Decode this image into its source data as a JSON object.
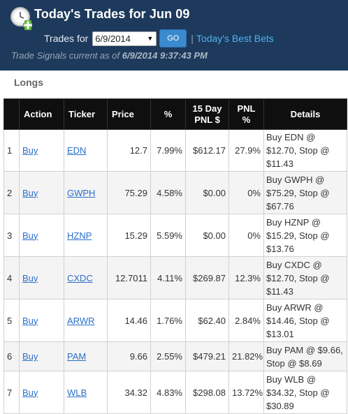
{
  "header": {
    "title": "Today's Trades for Jun 09",
    "trades_for_label": "Trades for",
    "date_value": "6/9/2014",
    "go_label": "GO",
    "separator": "|",
    "best_bets_link": "Today's Best Bets",
    "signals_prefix": "Trade Signals current as of",
    "signals_time": "6/9/2014 9:37:43 PM"
  },
  "section": {
    "title": "Longs"
  },
  "table": {
    "headers": {
      "index": "",
      "action": "Action",
      "ticker": "Ticker",
      "price": "Price",
      "pct": "%",
      "pnl15_line1": "15 Day",
      "pnl15_line2": "PNL $",
      "pnlpct_line1": "PNL",
      "pnlpct_line2": "%",
      "details": "Details"
    },
    "rows": [
      {
        "index": "1",
        "action": "Buy",
        "ticker": "EDN",
        "price": "12.7",
        "pct": "7.99%",
        "pnl15": "$612.17",
        "pnlpct": "27.9%",
        "details": "Buy EDN @ $12.70, Stop @ $11.43"
      },
      {
        "index": "2",
        "action": "Buy",
        "ticker": "GWPH",
        "price": "75.29",
        "pct": "4.58%",
        "pnl15": "$0.00",
        "pnlpct": "0%",
        "details": "Buy GWPH @ $75.29, Stop @ $67.76"
      },
      {
        "index": "3",
        "action": "Buy",
        "ticker": "HZNP",
        "price": "15.29",
        "pct": "5.59%",
        "pnl15": "$0.00",
        "pnlpct": "0%",
        "details": "Buy HZNP @ $15.29, Stop @ $13.76"
      },
      {
        "index": "4",
        "action": "Buy",
        "ticker": "CXDC",
        "price": "12.7011",
        "pct": "4.11%",
        "pnl15": "$269.87",
        "pnlpct": "12.3%",
        "details": "Buy CXDC @ $12.70, Stop @ $11.43"
      },
      {
        "index": "5",
        "action": "Buy",
        "ticker": "ARWR",
        "price": "14.46",
        "pct": "1.76%",
        "pnl15": "$62.40",
        "pnlpct": "2.84%",
        "details": "Buy ARWR @ $14.46, Stop @ $13.01"
      },
      {
        "index": "6",
        "action": "Buy",
        "ticker": "PAM",
        "price": "9.66",
        "pct": "2.55%",
        "pnl15": "$479.21",
        "pnlpct": "21.82%",
        "details": "Buy PAM @ $9.66, Stop @ $8.69"
      },
      {
        "index": "7",
        "action": "Buy",
        "ticker": "WLB",
        "price": "34.32",
        "pct": "4.83%",
        "pnl15": "$298.08",
        "pnlpct": "13.72%",
        "details": "Buy WLB @ $34.32, Stop @ $30.89"
      }
    ]
  },
  "icons": {
    "header_icon": "clock-add-icon",
    "select_arrow": "chevron-down-icon"
  },
  "colors": {
    "header_bg": "#1d3a5c",
    "link": "#2a6fc9",
    "go_button": "#3a8ad0",
    "table_header": "#0f0f0f"
  }
}
